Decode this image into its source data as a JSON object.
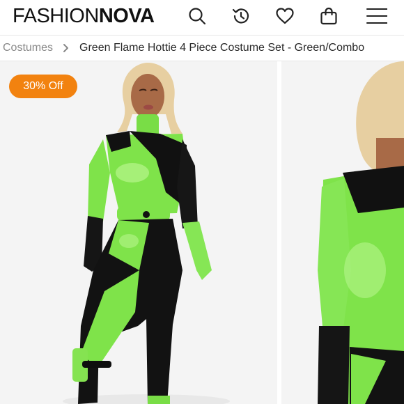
{
  "header": {
    "logo_light": "FASHION",
    "logo_bold": "NOVA",
    "icons": [
      "search-icon",
      "history-icon",
      "heart-icon",
      "bag-icon",
      "menu-icon"
    ]
  },
  "breadcrumb": {
    "parent": "Costumes",
    "current": "Green Flame Hottie 4 Piece Costume Set - Green/Combo"
  },
  "product": {
    "badge": "30% Off"
  },
  "colors": {
    "badge_bg": "#f2820f",
    "costume_green": "#7fe34a",
    "costume_black": "#111111"
  }
}
